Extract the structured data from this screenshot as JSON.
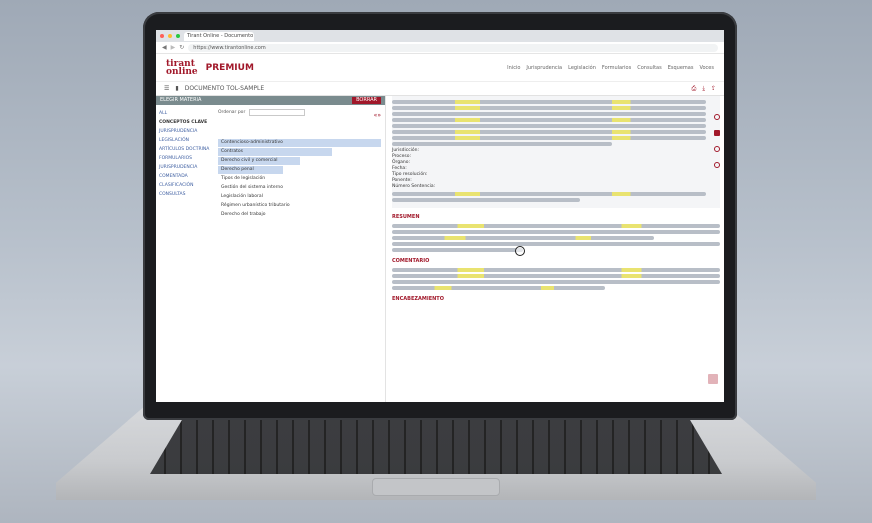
{
  "browser": {
    "tab_label": "Tirant Online - Documento",
    "url": "https://www.tirantonline.com"
  },
  "brand": {
    "logo_line1": "tirant",
    "logo_line2": "online",
    "product": "PREMIUM"
  },
  "nav": [
    "Inicio",
    "Jurisprudencia",
    "Legislación",
    "Formularios",
    "Consultas",
    "Esquemas",
    "Voces"
  ],
  "toolbar": {
    "title": "DOCUMENTO TOL-SAMPLE"
  },
  "left": {
    "header": "ELEGIR MATERIA",
    "header_btn": "BORRAR",
    "filters": [
      "ALL",
      "CONCEPTOS CLAVE",
      "JURISPRUDENCIA",
      "LEGISLACIÓN",
      "ARTÍCULOS DOCTRINA",
      "FORMULARIOS",
      "JURISPRUDENCIA COMENTADA",
      "CLASIFICACIÓN",
      "CONSULTAS"
    ],
    "select_label": "Ordenar por",
    "tree": [
      "Contencioso-administrativo",
      "Contratos",
      "Derecho civil y comercial",
      "Derecho penal",
      "Tipos de legislación",
      "Gestión del sistema interno",
      "Legislación laboral",
      "Régimen urbanístico tributario",
      "Derecho del trabajo"
    ]
  },
  "document": {
    "labels": {
      "jurisdiction": "Jurisdicción:",
      "process": "Proceso:",
      "organ": "Órgano:",
      "date": "Fecha:",
      "type": "Tipo resolución:",
      "ponente": "Ponente:",
      "number": "Número Sentencia:"
    },
    "section1": "RESUMEN",
    "section2": "COMENTARIO",
    "section3": "ENCABEZAMIENTO"
  }
}
